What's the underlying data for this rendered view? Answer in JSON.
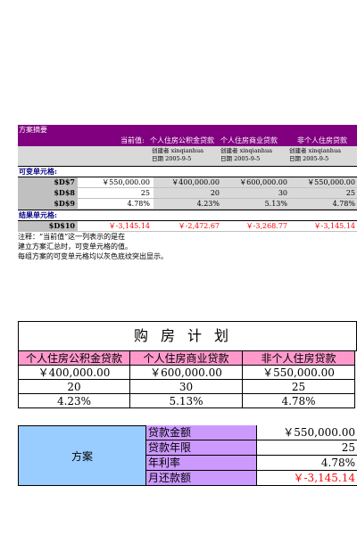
{
  "summary": {
    "title": "方案摘要",
    "current_values_header": "当前值:",
    "columns": [
      "个人住房公积金贷款",
      "个人住房商业贷款",
      "非个人住房贷款"
    ],
    "creators": [
      {
        "creator": "创建者 xinqianhua",
        "date": "日期 2005-9-5"
      },
      {
        "creator": "创建者 xinqianhua",
        "date": "日期 2005-9-5"
      },
      {
        "creator": "创建者 xinqianhua",
        "date": "日期 2005-9-5"
      }
    ],
    "variable_cells_label": "可变单元格:",
    "result_cells_label": "结果单元格:",
    "rows": [
      {
        "label": "$D$7",
        "values": [
          "￥550,000.00",
          "￥400,000.00",
          "￥600,000.00",
          "￥550,000.00"
        ]
      },
      {
        "label": "$D$8",
        "values": [
          "25",
          "20",
          "30",
          "25"
        ]
      },
      {
        "label": "$D$9",
        "values": [
          "4.78%",
          "4.23%",
          "5.13%",
          "4.78%"
        ]
      }
    ],
    "result_row": {
      "label": "$D$10",
      "values": [
        "￥-3,145.14",
        "￥-2,472.67",
        "￥-3,268.77",
        "￥-3,145.14"
      ]
    },
    "notes": [
      "注释：“当前值”这一列表示的是在",
      "建立方案汇总时，可变单元格的值。",
      "每组方案的可变单元格均以灰色底纹突出显示。"
    ]
  },
  "plan": {
    "title": "购房计划",
    "headers": [
      "个人住房公积金贷款",
      "个人住房商业贷款",
      "非个人住房贷款"
    ],
    "amounts": [
      "￥400,000.00",
      "￥600,000.00",
      "￥550,000.00"
    ],
    "years": [
      "20",
      "30",
      "25"
    ],
    "rates": [
      "4.23%",
      "5.13%",
      "4.78%"
    ]
  },
  "scheme": {
    "label": "方案",
    "rows": [
      {
        "key": "贷款金额",
        "value": "￥550,000.00"
      },
      {
        "key": "贷款年限",
        "value": "25"
      },
      {
        "key": "年利率",
        "value": "4.78%"
      },
      {
        "key": "月还款额",
        "value": "￥-3,145.14"
      }
    ]
  }
}
